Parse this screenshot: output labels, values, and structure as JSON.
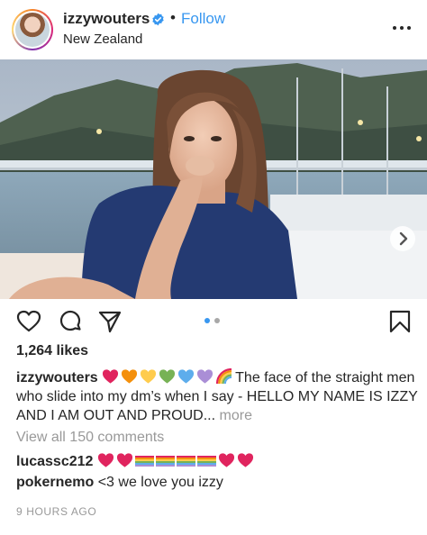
{
  "post": {
    "username": "izzywouters",
    "separator": "•",
    "follow_label": "Follow",
    "location": "New Zealand",
    "likes": "1,264 likes",
    "caption": {
      "username": "izzywouters",
      "emojis": [
        "red-heart",
        "orange-heart",
        "yellow-heart",
        "green-heart",
        "blue-heart",
        "purple-heart",
        "rainbow"
      ],
      "text": "The face of the straight men who slide into my dm’s when I say - HELLO MY NAME IS IZZY AND I AM OUT AND PROUD...",
      "more_label": "more"
    },
    "view_all_comments": "View all 150 comments",
    "comments": [
      {
        "username": "lucassc212",
        "text": "",
        "emojis": [
          "red-heart",
          "red-heart",
          "rainbow-flag",
          "rainbow-flag",
          "rainbow-flag",
          "rainbow-flag",
          "red-heart",
          "red-heart"
        ]
      },
      {
        "username": "pokernemo",
        "text": "<3 we love you izzy",
        "emojis": []
      }
    ],
    "timestamp": "9 HOURS AGO",
    "carousel": {
      "current": 1,
      "total": 2
    }
  },
  "icons": {
    "verified": "verified-badge-icon",
    "more": "more-options-icon",
    "like": "heart-icon",
    "comment": "comment-icon",
    "share": "share-icon",
    "save": "bookmark-icon",
    "next": "chevron-right-icon"
  },
  "colors": {
    "accent": "#3897f0",
    "muted": "#999999",
    "text": "#262626"
  }
}
